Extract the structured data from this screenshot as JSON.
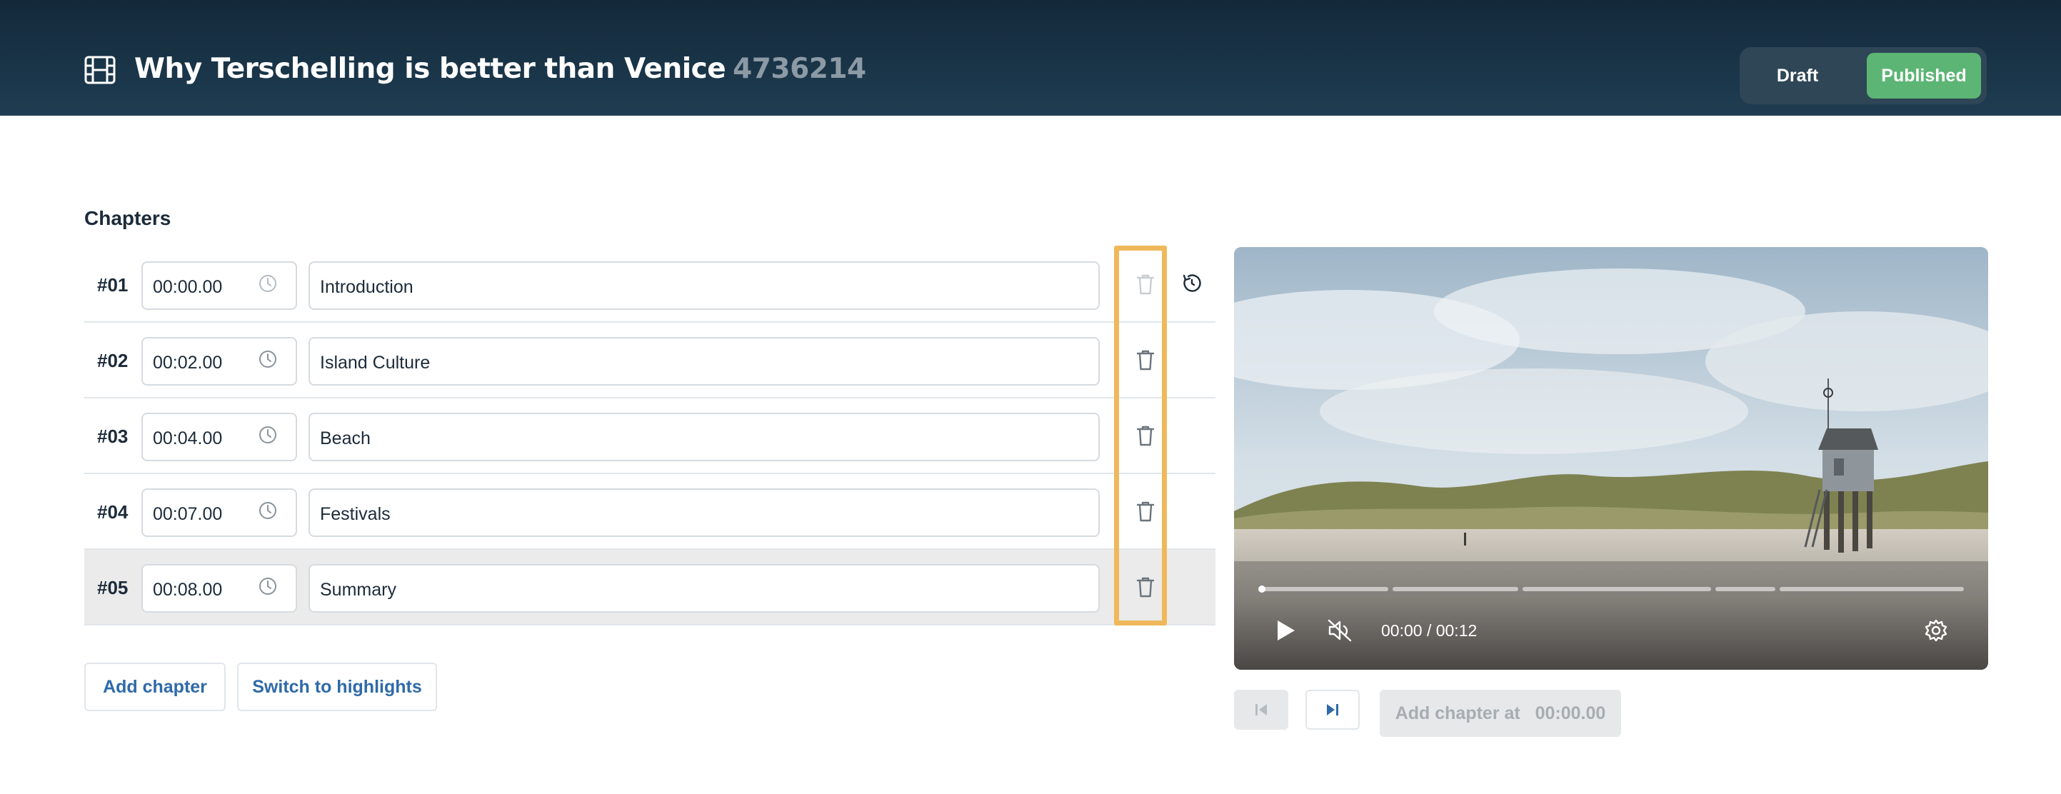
{
  "header": {
    "title": "Why Terschelling is better than Venice",
    "id": "4736214",
    "status": {
      "draft_label": "Draft",
      "published_label": "Published",
      "selected": "Published",
      "accent": "#5cb574"
    }
  },
  "chapters": {
    "section_title": "Chapters",
    "items": [
      {
        "number": "#01",
        "time": "00:00.00",
        "title": "Introduction"
      },
      {
        "number": "#02",
        "time": "00:02.00",
        "title": "Island Culture"
      },
      {
        "number": "#03",
        "time": "00:04.00",
        "title": "Beach"
      },
      {
        "number": "#04",
        "time": "00:07.00",
        "title": "Festivals"
      },
      {
        "number": "#05",
        "time": "00:08.00",
        "title": "Summary"
      }
    ],
    "add_label": "Add chapter",
    "switch_label": "Switch to highlights",
    "highlight_color": "#efb85a"
  },
  "player": {
    "time_display": "00:00 / 00:12",
    "add_chapter_label": "Add chapter at",
    "add_chapter_time": "00:00.00"
  }
}
